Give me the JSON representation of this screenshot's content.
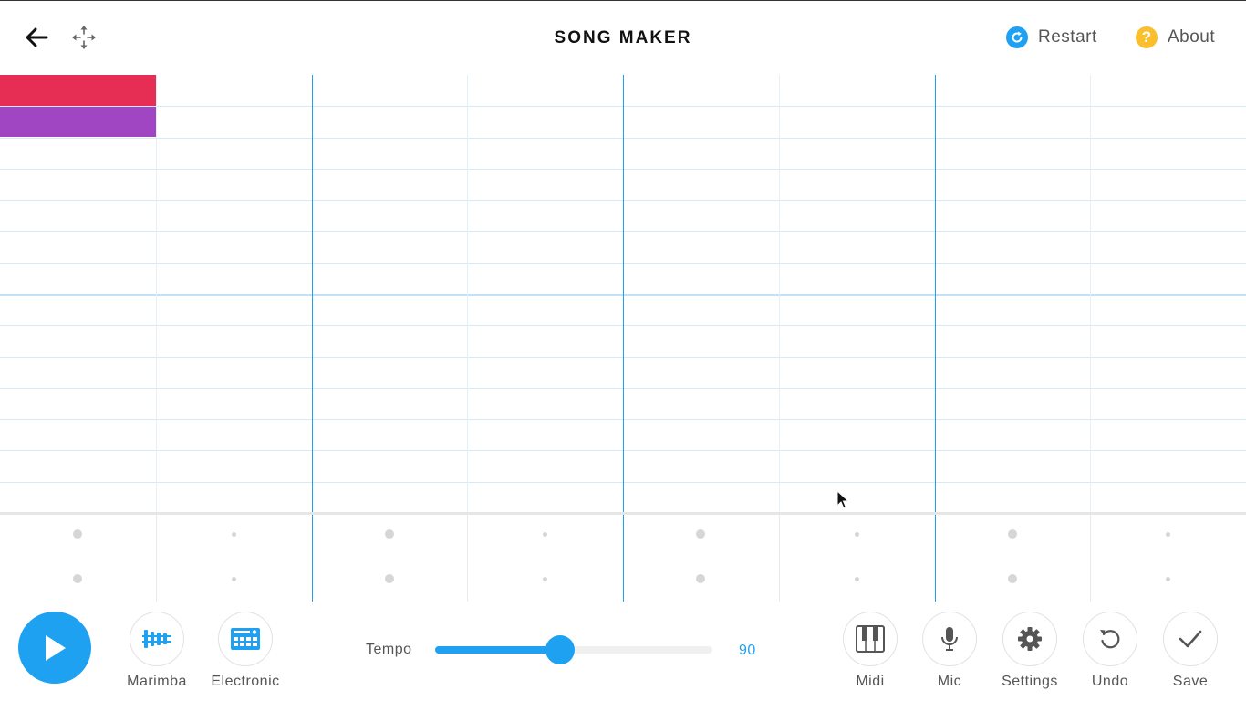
{
  "header": {
    "title": "SONG MAKER",
    "restart_label": "Restart",
    "about_label": "About",
    "about_glyph": "?",
    "icons": [
      "arrow-left-icon",
      "move-arrows-icon",
      "restart-icon",
      "help-icon"
    ]
  },
  "grid": {
    "rows": 14,
    "columns": 32,
    "beats_per_bar": 4,
    "bars": 2,
    "notes": [
      {
        "row": 0,
        "col_start": 0,
        "col_end": 3,
        "color": "#e62e54"
      },
      {
        "row": 1,
        "col_start": 0,
        "col_end": 3,
        "color": "#a046c3"
      }
    ]
  },
  "colors": {
    "accent": "#1ea1f0",
    "grid_line": "#d6ebf7",
    "note_red": "#e62e54",
    "note_purple": "#a046c3",
    "help_yellow": "#fbbf2d"
  },
  "toolbar": {
    "play_icon": "play-icon",
    "marimba_label": "Marimba",
    "electronic_label": "Electronic",
    "tempo_label": "Tempo",
    "tempo_value": "90",
    "tempo_fraction": 0.45,
    "midi_label": "Midi",
    "mic_label": "Mic",
    "settings_label": "Settings",
    "undo_label": "Undo",
    "save_label": "Save"
  }
}
